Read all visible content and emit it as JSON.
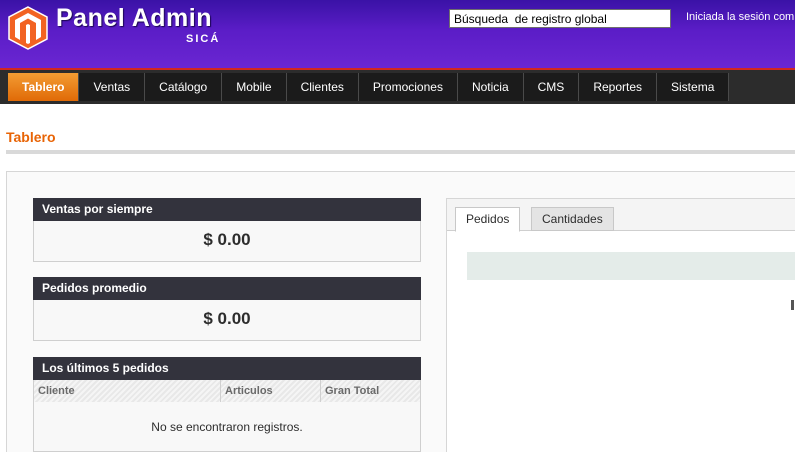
{
  "header": {
    "brand": "Panel Admin",
    "brand_sub": "SICÁ",
    "search_value": "Búsqueda  de registro global",
    "session_text": "Iniciada la sesión com"
  },
  "colors": {
    "header_purple": "#5b1dc7",
    "nav_active_orange": "#e06a07",
    "title_orange": "#e86406",
    "box_header": "#33333d"
  },
  "nav": {
    "items": [
      {
        "label": "Tablero",
        "active": true
      },
      {
        "label": "Ventas",
        "active": false
      },
      {
        "label": "Catálogo",
        "active": false
      },
      {
        "label": "Mobile",
        "active": false
      },
      {
        "label": "Clientes",
        "active": false
      },
      {
        "label": "Promociones",
        "active": false
      },
      {
        "label": "Noticia",
        "active": false
      },
      {
        "label": "CMS",
        "active": false
      },
      {
        "label": "Reportes",
        "active": false
      },
      {
        "label": "Sistema",
        "active": false
      }
    ]
  },
  "page": {
    "title": "Tablero"
  },
  "sales_box": {
    "title": "Ventas por siempre",
    "amount": "$ 0.00"
  },
  "avg_box": {
    "title": "Pedidos promedio",
    "amount": "$ 0.00"
  },
  "orders_box": {
    "title": "Los últimos 5 pedidos",
    "columns": [
      "Cliente",
      "Articulos",
      "Gran Total"
    ],
    "empty_message": "No se encontraron registros."
  },
  "chart_tabs": [
    {
      "label": "Pedidos",
      "active": true
    },
    {
      "label": "Cantidades",
      "active": false
    }
  ]
}
